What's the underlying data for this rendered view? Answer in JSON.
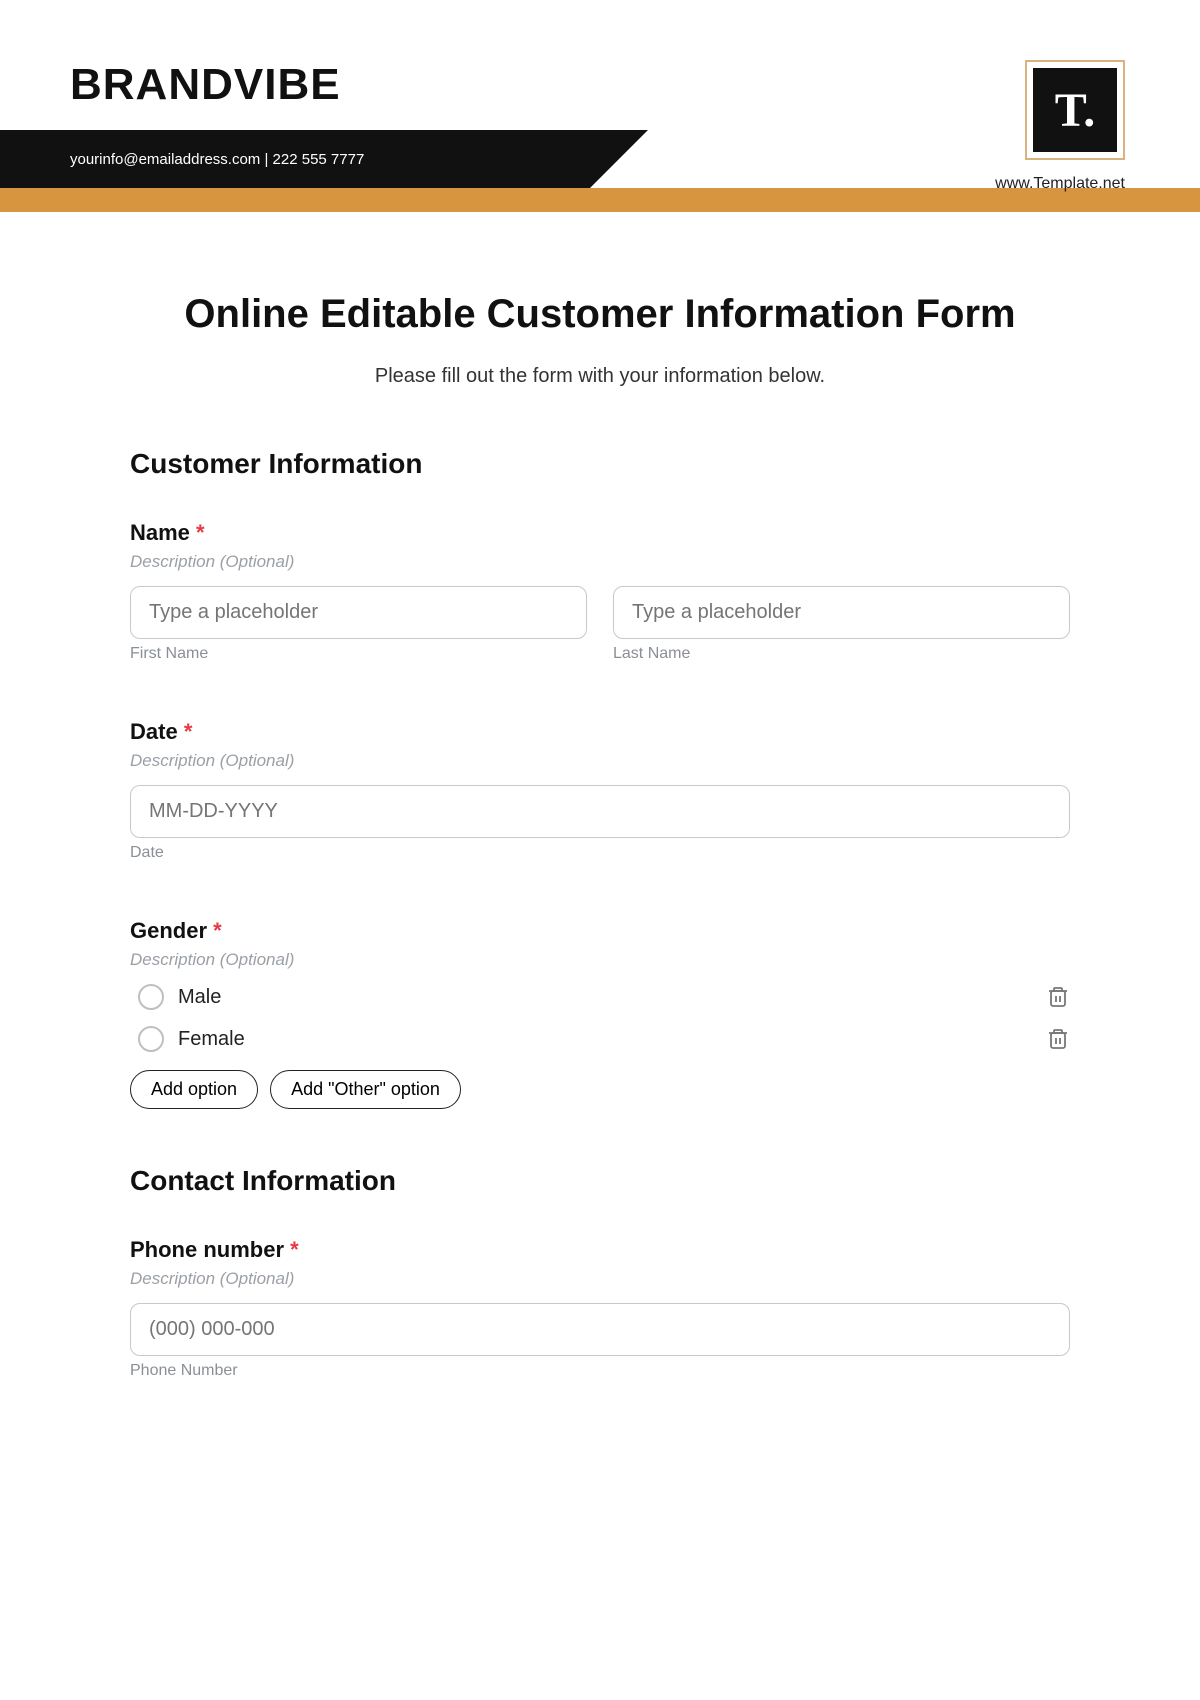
{
  "header": {
    "brand": "BRANDVIBE",
    "contact_line": "yourinfo@emailaddress.com  |  222 555 7777",
    "logo_text": "T.",
    "logo_url": "www.Template.net"
  },
  "form": {
    "title": "Online Editable Customer Information Form",
    "subtitle": "Please fill out the form with your information below.",
    "desc_placeholder": "Description (Optional)",
    "sections": {
      "customer": {
        "heading": "Customer Information",
        "name": {
          "label": "Name",
          "required": "*",
          "first_placeholder": "Type a placeholder",
          "first_sub": "First Name",
          "last_placeholder": "Type a placeholder",
          "last_sub": "Last Name"
        },
        "date": {
          "label": "Date",
          "required": "*",
          "placeholder": "MM-DD-YYYY",
          "sub": "Date"
        },
        "gender": {
          "label": "Gender",
          "required": "*",
          "options": [
            "Male",
            "Female"
          ],
          "add_option": "Add option",
          "add_other": "Add \"Other\" option"
        }
      },
      "contact": {
        "heading": "Contact Information",
        "phone": {
          "label": "Phone number",
          "required": "*",
          "placeholder": "(000) 000-000",
          "sub": "Phone Number"
        }
      }
    }
  }
}
